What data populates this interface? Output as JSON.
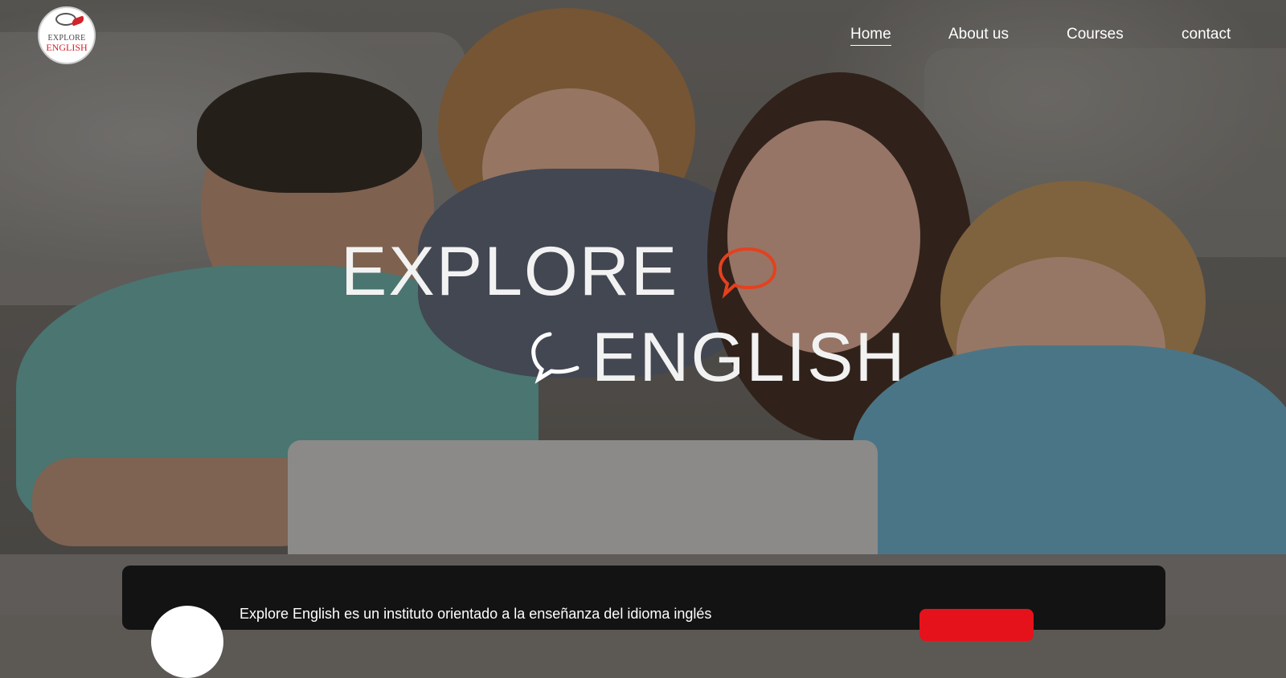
{
  "brand": {
    "logo_line1": "EXPLORE",
    "logo_line2": "ENGLISH",
    "accent_color": "#d2232a"
  },
  "nav": {
    "items": [
      {
        "label": "Home",
        "active": true
      },
      {
        "label": "About us",
        "active": false
      },
      {
        "label": "Courses",
        "active": false
      },
      {
        "label": "contact",
        "active": false
      }
    ]
  },
  "hero": {
    "title_line1": "EXPLORE",
    "title_line2": "ENGLISH",
    "bubble_icon_color_1": "#e4411f",
    "bubble_icon_color_2": "#ffffff"
  },
  "info": {
    "text": "Explore English es un instituto orientado a la enseñanza del idioma inglés",
    "button_color": "#e5121b"
  }
}
